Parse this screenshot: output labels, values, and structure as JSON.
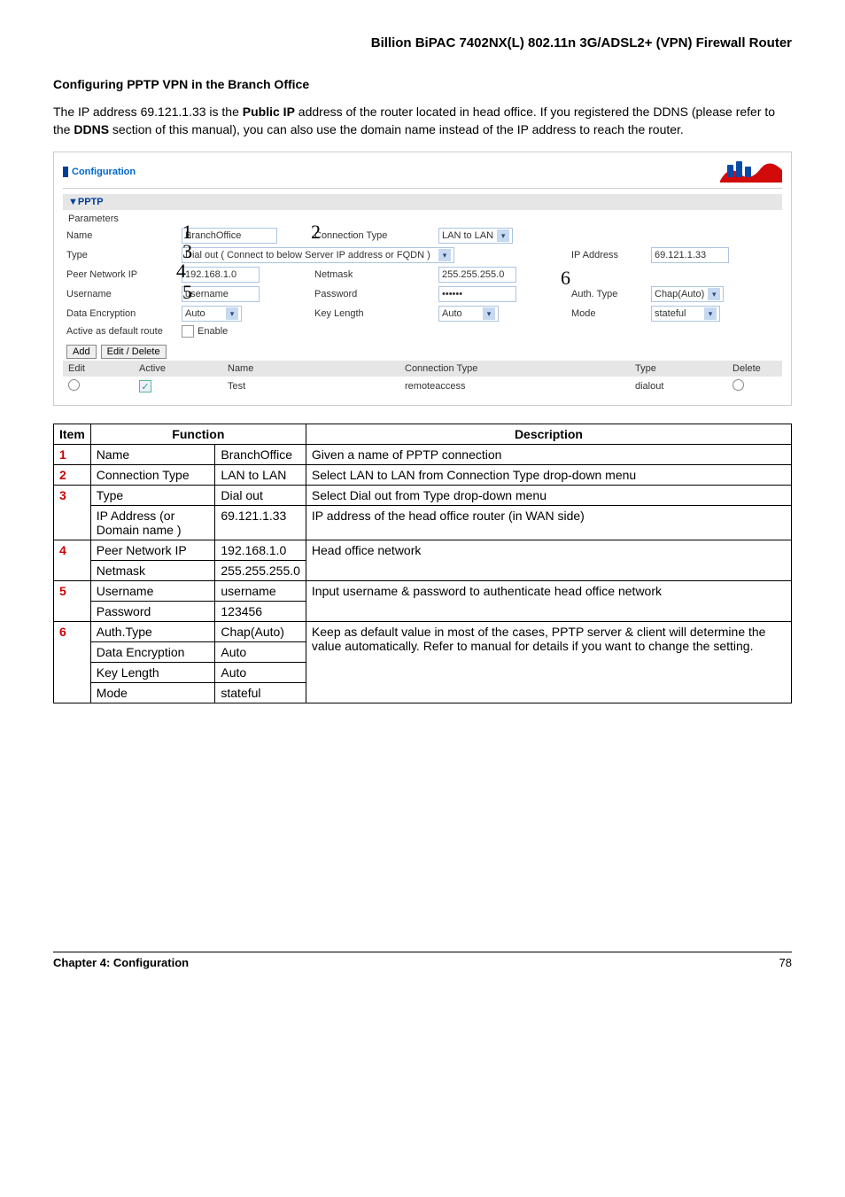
{
  "page": {
    "header": "Billion BiPAC 7402NX(L) 802.11n 3G/ADSL2+ (VPN) Firewall Router",
    "section_title": "Configuring PPTP VPN in the Branch Office",
    "intro_pre": "The IP address 69.121.1.33 is the ",
    "intro_bold1": "Public IP",
    "intro_mid": " address of the router located in head office. If you registered the DDNS (please refer to the ",
    "intro_bold2": "DDNS",
    "intro_post": " section of this manual), you can also use the domain name instead of the IP address to reach the router.",
    "footer_chapter": "Chapter 4: Configuration",
    "footer_page": "78"
  },
  "config": {
    "title": "Configuration",
    "section": "▼PPTP",
    "params_label": "Parameters",
    "labels": {
      "name": "Name",
      "conn_type": "Connection Type",
      "type": "Type",
      "ip_addr": "IP Address",
      "peer_net": "Peer Network IP",
      "netmask": "Netmask",
      "username": "Username",
      "password": "Password",
      "auth_type": "Auth. Type",
      "data_enc": "Data Encryption",
      "key_len": "Key Length",
      "mode": "Mode",
      "active_default": "Active as default route",
      "enable": "Enable"
    },
    "values": {
      "name": "BranchOffice",
      "conn_type": "LAN to LAN",
      "type": "Dial out ( Connect to below Server IP address or FQDN )",
      "ip_addr": "69.121.1.33",
      "peer_net": "192.168.1.0",
      "netmask": "255.255.255.0",
      "username": "username",
      "password": "••••••",
      "auth_type": "Chap(Auto)",
      "data_enc": "Auto",
      "key_len": "Auto",
      "mode": "stateful"
    },
    "buttons": {
      "add": "Add",
      "edit_delete": "Edit / Delete"
    },
    "table": {
      "headers": {
        "edit": "Edit",
        "active": "Active",
        "name": "Name",
        "conn_type": "Connection Type",
        "type": "Type",
        "delete": "Delete"
      },
      "row": {
        "name": "Test",
        "conn_type": "remoteaccess",
        "type": "dialout"
      }
    },
    "overlays": {
      "n1": "1",
      "n2": "2",
      "n3": "3",
      "n4": "4",
      "n5": "5",
      "n6": "6"
    }
  },
  "ref_table": {
    "headers": {
      "item": "Item",
      "function": "Function",
      "description": "Description"
    },
    "rows": {
      "r1": {
        "item": "1",
        "fn": "Name",
        "val": "BranchOffice",
        "desc": "Given a name of PPTP connection"
      },
      "r2": {
        "item": "2",
        "fn": "Connection Type",
        "val": "LAN to LAN",
        "desc": "Select LAN to LAN from Connection Type drop-down menu"
      },
      "r3": {
        "item": "3",
        "fn_a": "Type",
        "val_a": "Dial out",
        "desc_a": "Select Dial out from Type drop-down menu",
        "fn_b": "IP Address (or Domain name )",
        "val_b": "69.121.1.33",
        "desc_b": "IP address of the head office router (in WAN side)"
      },
      "r4": {
        "item": "4",
        "fn_a": "Peer Network IP",
        "val_a": "192.168.1.0",
        "fn_b": "Netmask",
        "val_b": "255.255.255.0",
        "desc": "Head office network"
      },
      "r5": {
        "item": "5",
        "fn_a": "Username",
        "val_a": "username",
        "fn_b": "Password",
        "val_b": "123456",
        "desc": "Input username & password to authenticate head office network"
      },
      "r6": {
        "item": "6",
        "fn_a": "Auth.Type",
        "val_a": "Chap(Auto)",
        "fn_b": "Data Encryption",
        "val_b": "Auto",
        "fn_c": "Key Length",
        "val_c": "Auto",
        "fn_d": "Mode",
        "val_d": "stateful",
        "desc": "Keep as default value in most of the cases, PPTP server & client will determine the value automatically. Refer to manual for details if you want to change the setting."
      }
    }
  }
}
